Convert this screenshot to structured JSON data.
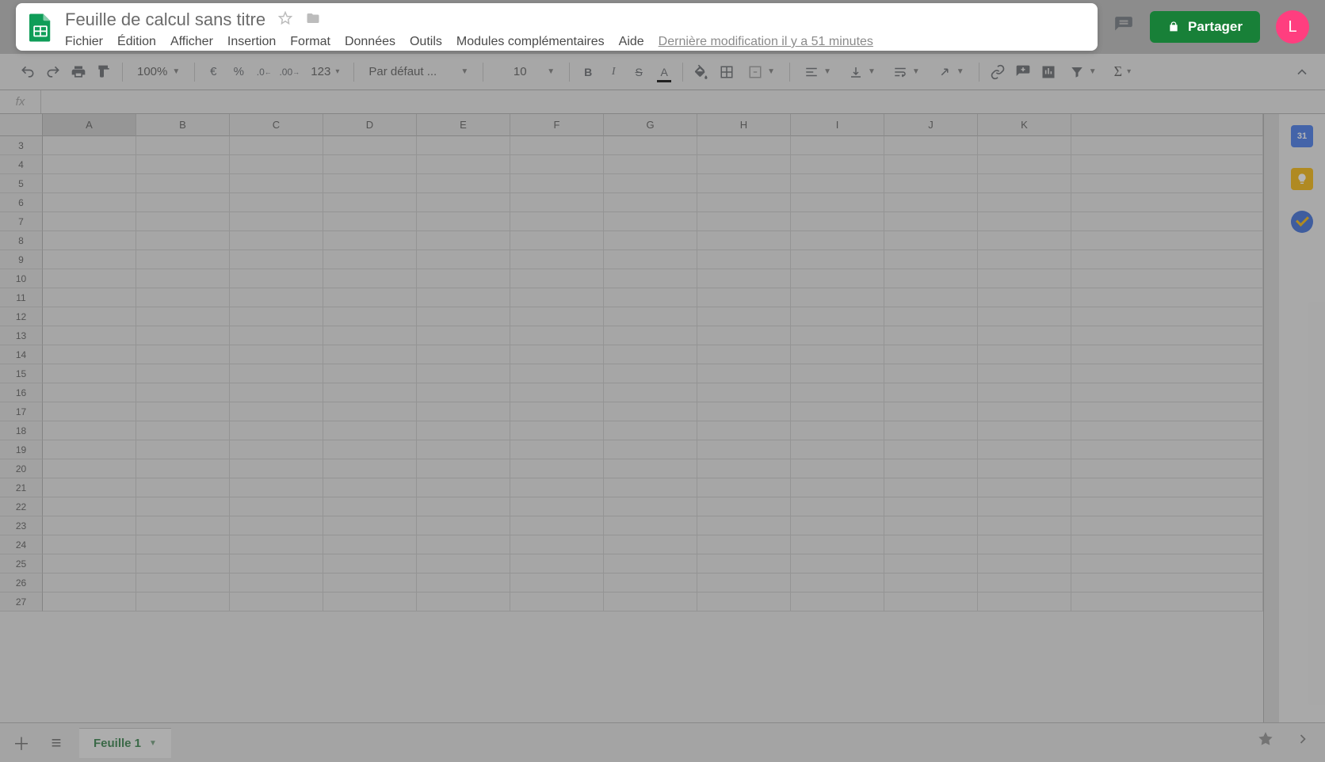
{
  "header": {
    "doc_title": "Feuille de calcul sans titre",
    "last_modified": "Dernière modification il y a 51 minutes",
    "share_label": "Partager",
    "avatar_initial": "L"
  },
  "menus": [
    "Fichier",
    "Édition",
    "Afficher",
    "Insertion",
    "Format",
    "Données",
    "Outils",
    "Modules complémentaires",
    "Aide"
  ],
  "toolbar": {
    "zoom": "100%",
    "currency": "€",
    "percent": "%",
    "dec_less": ".0_",
    "dec_more": ".00",
    "num_format": "123",
    "font_name": "Par défaut ...",
    "font_size": "10"
  },
  "grid": {
    "columns": [
      "A",
      "B",
      "C",
      "D",
      "E",
      "F",
      "G",
      "H",
      "I",
      "J",
      "K"
    ],
    "row_start": 3,
    "row_end": 27
  },
  "sheet_bar": {
    "active_tab": "Feuille 1"
  },
  "side_panel": {
    "calendar_day": "31"
  }
}
